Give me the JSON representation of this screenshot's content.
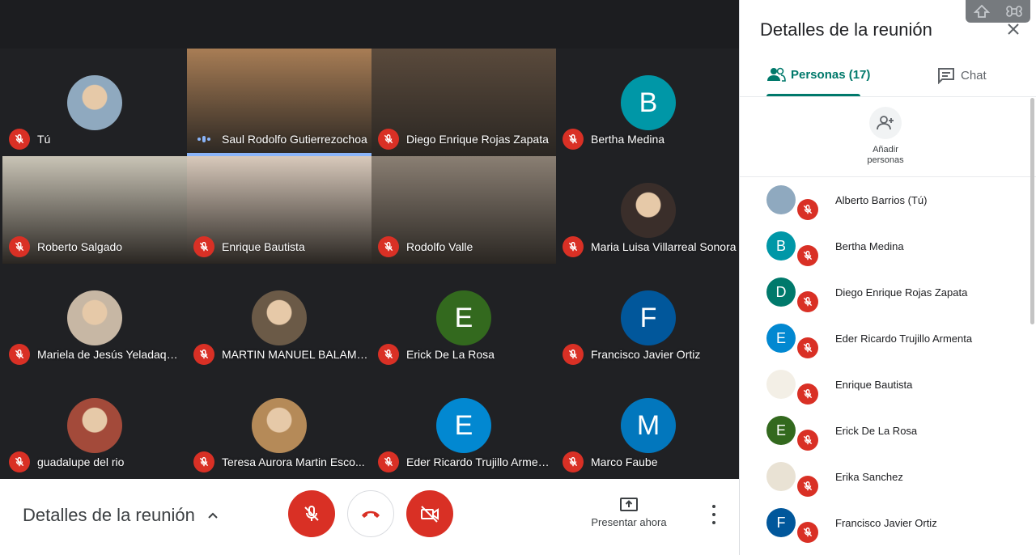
{
  "stage": {
    "tiles": [
      {
        "name": "Tú",
        "type": "photo",
        "photo_bg": "#8fa9bf",
        "mic": "off"
      },
      {
        "name": "Saul Rodolfo Gutierrezochoa",
        "type": "video",
        "video_bg": "#a87d55",
        "mic": "speaking",
        "active": true
      },
      {
        "name": "Diego Enrique Rojas Zapata",
        "type": "video",
        "video_bg": "#5a4a3c",
        "mic": "off"
      },
      {
        "name": "Bertha Medina",
        "type": "letter",
        "letter": "B",
        "color": "#0097a7",
        "mic": "off"
      },
      {
        "name": "Roberto Salgado",
        "type": "video",
        "video_bg": "#c9c4b6",
        "mic": "off"
      },
      {
        "name": "Enrique Bautista",
        "type": "video",
        "video_bg": "#d8c9bb",
        "mic": "off"
      },
      {
        "name": "Rodolfo Valle",
        "type": "video",
        "video_bg": "#8a7f73",
        "mic": "off"
      },
      {
        "name": "Maria Luisa Villarreal Sonora",
        "type": "photo",
        "photo_bg": "#3a2e2a",
        "mic": "off"
      },
      {
        "name": "Mariela de Jesús Yeladaqui...",
        "type": "photo",
        "photo_bg": "#c7b7a4",
        "mic": "off"
      },
      {
        "name": "MARTIN MANUEL BALAM ...",
        "type": "photo",
        "photo_bg": "#6b5a47",
        "mic": "off"
      },
      {
        "name": "Erick De La Rosa",
        "type": "letter",
        "letter": "E",
        "color": "#33691e",
        "mic": "off"
      },
      {
        "name": "Francisco Javier Ortiz",
        "type": "letter",
        "letter": "F",
        "color": "#01579b",
        "mic": "off"
      },
      {
        "name": "guadalupe del rio",
        "type": "photo",
        "photo_bg": "#a34a3a",
        "mic": "off"
      },
      {
        "name": "Teresa Aurora Martin Esco...",
        "type": "photo",
        "photo_bg": "#b58a58",
        "mic": "off"
      },
      {
        "name": "Eder Ricardo Trujillo Armenta",
        "type": "letter",
        "letter": "E",
        "color": "#0288d1",
        "mic": "off"
      },
      {
        "name": "Marco Faube",
        "type": "letter",
        "letter": "M",
        "color": "#0277bd",
        "mic": "off"
      }
    ]
  },
  "bottombar": {
    "details_label": "Detalles de la reunión",
    "present_label": "Presentar ahora"
  },
  "panel": {
    "title": "Detalles de la reunión",
    "tab_people": "Personas (17)",
    "tab_chat": "Chat",
    "add_people": "Añadir personas",
    "people": [
      {
        "name": "Alberto Barrios (Tú)",
        "letter": "",
        "color": "#8fa9bf"
      },
      {
        "name": "Bertha Medina",
        "letter": "B",
        "color": "#0097a7"
      },
      {
        "name": "Diego Enrique Rojas Zapata",
        "letter": "D",
        "color": "#00796b"
      },
      {
        "name": "Eder Ricardo Trujillo Armenta",
        "letter": "E",
        "color": "#0288d1"
      },
      {
        "name": "Enrique Bautista",
        "letter": "",
        "color": "#f3efe6"
      },
      {
        "name": "Erick De La Rosa",
        "letter": "E",
        "color": "#33691e"
      },
      {
        "name": "Erika Sanchez",
        "letter": "",
        "color": "#e9e2d4"
      },
      {
        "name": "Francisco Javier Ortiz",
        "letter": "F",
        "color": "#01579b"
      }
    ]
  },
  "colors": {
    "accent": "#00796b",
    "mic_off": "#d93025",
    "speaking": "#8ab4f8"
  }
}
